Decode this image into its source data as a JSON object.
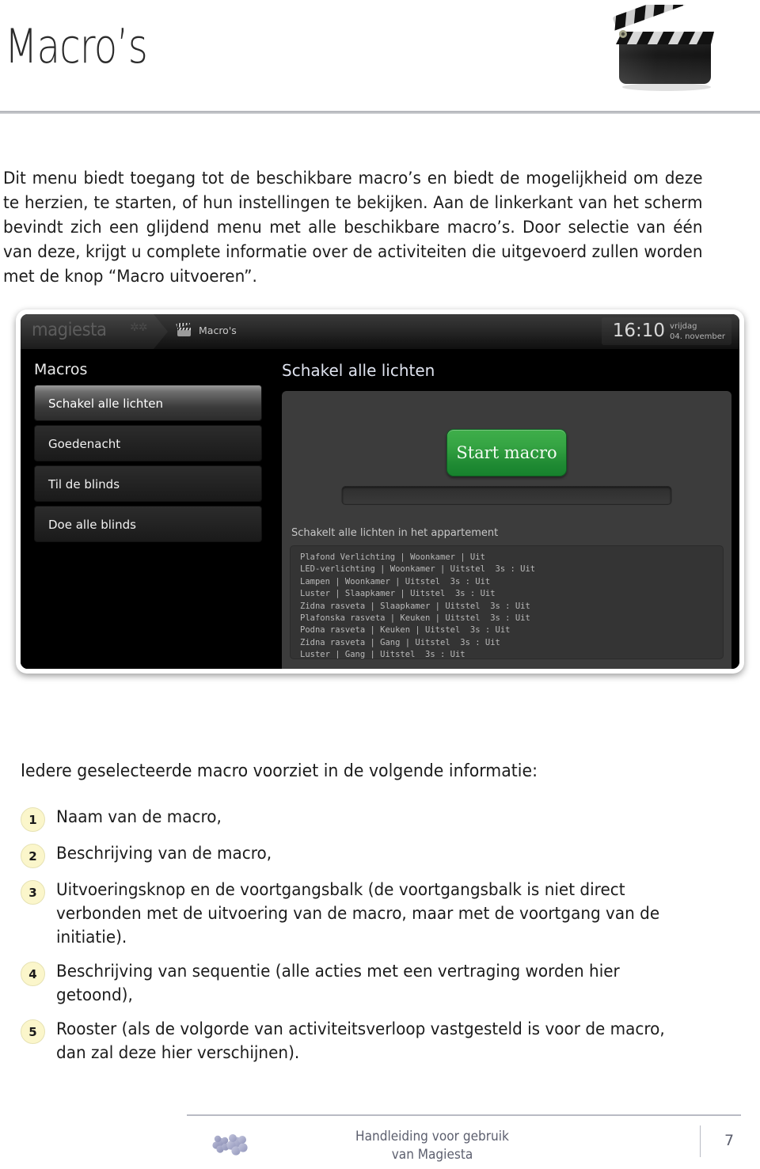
{
  "header": {
    "title": "Macro’s",
    "icon": "clapperboard-icon"
  },
  "intro": {
    "paragraph": "Dit menu biedt toegang tot de beschikbare macro’s en biedt de mogelijkheid om deze te herzien, te starten, of hun instellingen te bekijken. Aan de linkerkant van het scherm bevindt zich een glijdend menu met alle beschikbare macro’s. Door selectie van één van deze, krijgt u complete informatie over de activiteiten die uitgevoerd zullen worden met de knop “Macro uitvoeren”."
  },
  "screenshot": {
    "topbar": {
      "logo": "magiesta",
      "logo_mark": "⁂",
      "breadcrumb_icon": "clapperboard-icon",
      "breadcrumb_label": "Macro's",
      "clock_time": "16:10",
      "clock_day": "vrijdag",
      "clock_date": "04. november"
    },
    "sidebar": {
      "title": "Macros",
      "items": [
        {
          "label": "Schakel alle lichten",
          "selected": true
        },
        {
          "label": "Goedenacht",
          "selected": false
        },
        {
          "label": "Til de blinds",
          "selected": false
        },
        {
          "label": "Doe alle blinds",
          "selected": false
        }
      ]
    },
    "main": {
      "title": "Schakel alle lichten",
      "start_button": "Start macro",
      "description": "Schakelt alle lichten in het appartement",
      "sequence": [
        "Plafond Verlichting | Woonkamer | Uit",
        "LED-verlichting | Woonkamer | Uitstel  3s : Uit",
        "Lampen | Woonkamer | Uitstel  3s : Uit",
        "Luster | Slaapkamer | Uitstel  3s : Uit",
        "Zidna rasveta | Slaapkamer | Uitstel  3s : Uit",
        "Plafonska rasveta | Keuken | Uitstel  3s : Uit",
        "Podna rasveta | Keuken | Uitstel  3s : Uit",
        "Zidna rasveta | Gang | Uitstel  3s : Uit",
        "Luster | Gang | Uitstel  3s : Uit"
      ]
    },
    "colors": {
      "start_button_green": "#2a9a3c",
      "panel_background": "#000000",
      "card_background": "#3c3c3c"
    }
  },
  "list_section": {
    "heading": "Iedere geselecteerde macro voorziet in de volgende informatie:",
    "items": [
      {
        "number": "1",
        "text": "Naam van de macro,"
      },
      {
        "number": "2",
        "text": "Beschrijving van de macro,"
      },
      {
        "number": "3",
        "text": "Uitvoeringsknop en de voortgangsbalk (de voortgangsbalk is niet direct verbonden met de uitvoering van de macro, maar met de voortgang van de initiatie)."
      },
      {
        "number": "4",
        "text": "Beschrijving van sequentie (alle acties met een vertraging worden hier getoond),"
      },
      {
        "number": "5",
        "text": "Rooster (als de volgorde van activiteitsverloop vastgesteld is voor de macro, dan zal deze hier verschijnen)."
      }
    ],
    "badge_color": "#fbf6cb"
  },
  "footer": {
    "logo": "magiesta-flower-logo",
    "line1": "Handleiding voor gebruik",
    "line2": "van Magiesta",
    "page_number": "7"
  }
}
